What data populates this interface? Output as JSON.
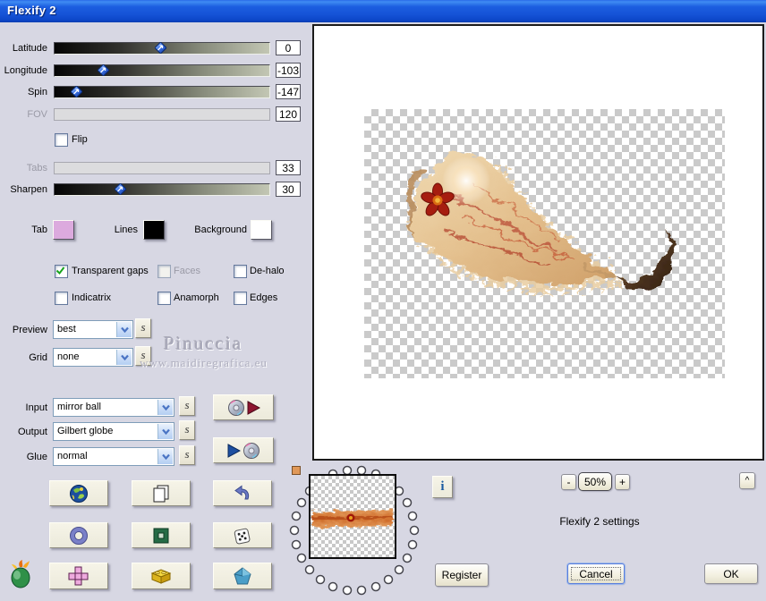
{
  "window": {
    "title": "Flexify 2"
  },
  "sliders": {
    "latitude": {
      "label": "Latitude",
      "value": "0"
    },
    "longitude": {
      "label": "Longitude",
      "value": "-103"
    },
    "spin": {
      "label": "Spin",
      "value": "-147"
    },
    "fov": {
      "label": "FOV",
      "value": "120"
    },
    "tabs": {
      "label": "Tabs",
      "value": "33"
    },
    "sharpen": {
      "label": "Sharpen",
      "value": "30"
    }
  },
  "flip_label": "Flip",
  "swatches": {
    "tab": {
      "label": "Tab",
      "color": "#dcaade"
    },
    "lines": {
      "label": "Lines",
      "color": "#000000"
    },
    "background": {
      "label": "Background",
      "color": "#ffffff"
    }
  },
  "checkboxes": {
    "transparent_gaps": {
      "label": "Transparent gaps",
      "checked": true
    },
    "faces": {
      "label": "Faces",
      "checked": false
    },
    "dehalo": {
      "label": "De-halo",
      "checked": false
    },
    "indicatrix": {
      "label": "Indicatrix",
      "checked": false
    },
    "anamorph": {
      "label": "Anamorph",
      "checked": false
    },
    "edges": {
      "label": "Edges",
      "checked": false
    }
  },
  "combos": {
    "preview": {
      "label": "Preview",
      "value": "best"
    },
    "grid": {
      "label": "Grid",
      "value": "none"
    },
    "input": {
      "label": "Input",
      "value": "mirror ball"
    },
    "output": {
      "label": "Output",
      "value": "Gilbert globe"
    },
    "glue": {
      "label": "Glue",
      "value": "normal"
    }
  },
  "s_button_label": "s",
  "watermark": {
    "line1": "Pinuccia",
    "line2": "www.maidiregrafica.eu"
  },
  "info_button_label": "i",
  "zoom": {
    "minus_label": "-",
    "level": "50%",
    "plus_label": "+"
  },
  "collapse_label": "^",
  "status_text": "Flexify 2 settings",
  "action_buttons": {
    "register": "Register",
    "cancel": "Cancel",
    "ok": "OK"
  },
  "icon_names": {
    "grid_row1": [
      "earth-icon",
      "copy-icon",
      "undo-icon"
    ],
    "grid_row2": [
      "torus-icon",
      "green-frame-icon",
      "dice-icon"
    ],
    "grid_row3": [
      "cross-net-icon",
      "brick-icon",
      "gem-icon"
    ],
    "load_button": [
      "cd-icon",
      "play-red-icon"
    ],
    "save_button": [
      "play-blue-icon",
      "cd-icon"
    ],
    "logo": "flaming-pear-icon"
  }
}
